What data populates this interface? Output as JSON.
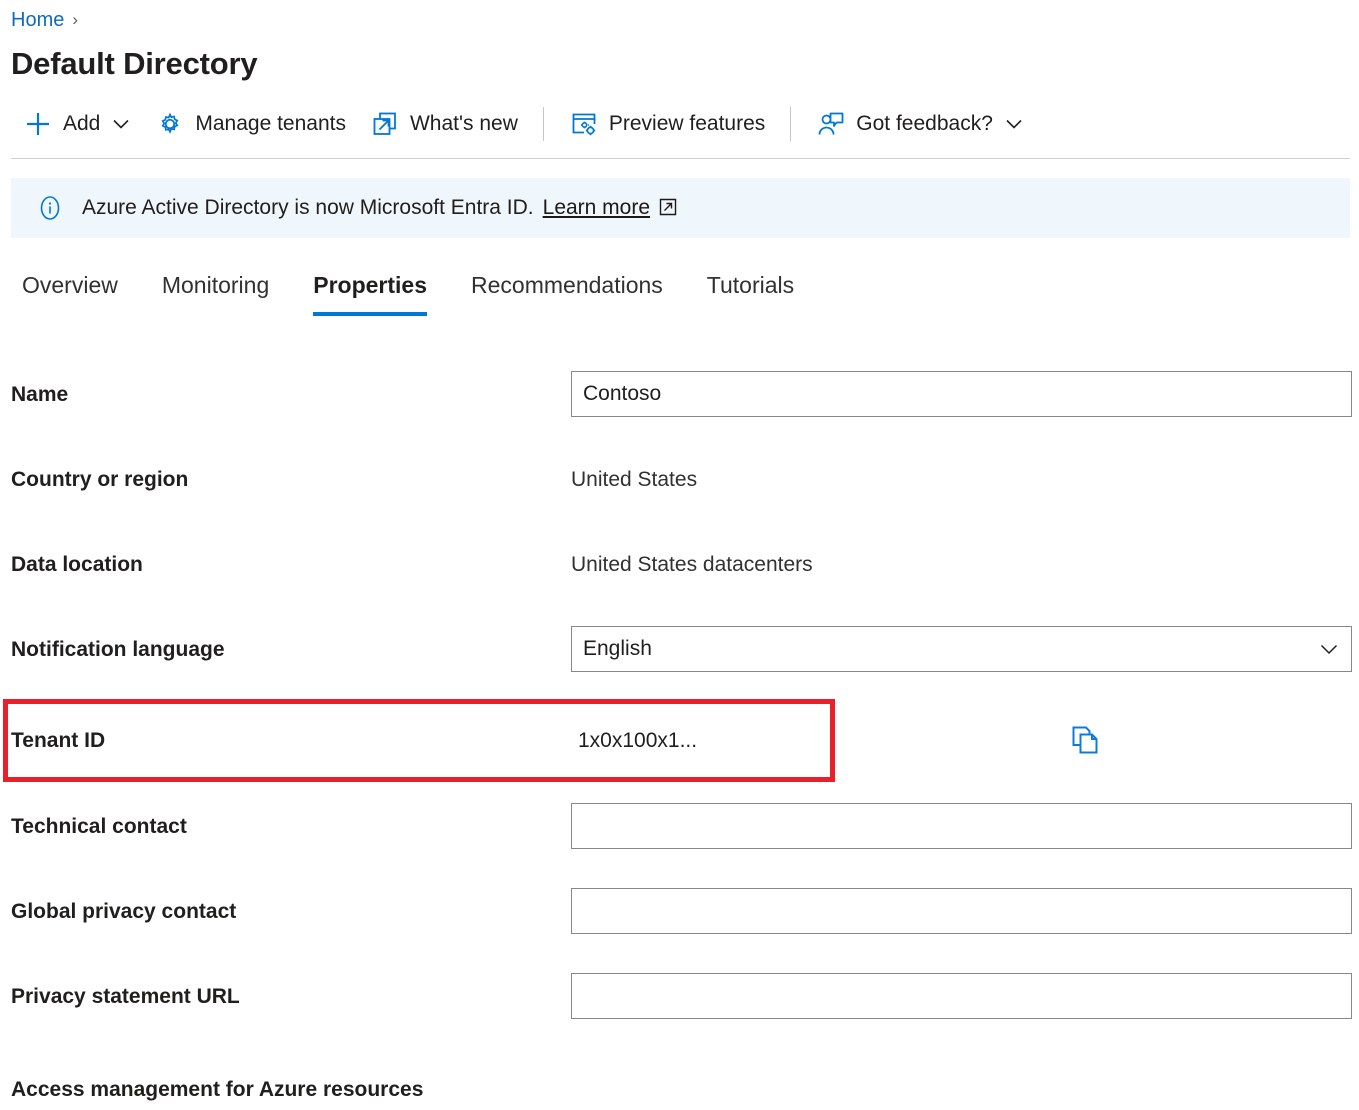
{
  "breadcrumb": {
    "home_label": "Home",
    "separator": "›"
  },
  "page_title": "Default Directory",
  "toolbar": {
    "items": [
      {
        "label": "Add",
        "icon": "plus-icon",
        "has_chevron": true
      },
      {
        "label": "Manage tenants",
        "icon": "gear-icon",
        "has_chevron": false
      },
      {
        "label": "What's new",
        "icon": "external-window-icon",
        "has_chevron": false
      },
      {
        "label": "Preview features",
        "icon": "preview-features-icon",
        "has_chevron": false
      },
      {
        "label": "Got feedback?",
        "icon": "feedback-person-icon",
        "has_chevron": true
      }
    ]
  },
  "banner": {
    "icon": "info-icon",
    "text": "Azure Active Directory is now Microsoft Entra ID.",
    "link_label": "Learn more",
    "link_icon": "external-link-icon",
    "background_color": "#eff6fc"
  },
  "tabs": {
    "items": [
      {
        "label": "Overview",
        "active": false
      },
      {
        "label": "Monitoring",
        "active": false
      },
      {
        "label": "Properties",
        "active": true
      },
      {
        "label": "Recommendations",
        "active": false
      },
      {
        "label": "Tutorials",
        "active": false
      }
    ],
    "active_underline_color": "#0078d4"
  },
  "form": {
    "name": {
      "label": "Name",
      "value": "Contoso",
      "placeholder": ""
    },
    "country_or_region": {
      "label": "Country or region",
      "value": "United States"
    },
    "data_location": {
      "label": "Data location",
      "value": "United States datacenters"
    },
    "notification_language": {
      "label": "Notification language",
      "value": "English",
      "chevron_icon": "chevron-down-icon"
    },
    "tenant_id": {
      "label": "Tenant ID",
      "value": "1x0x100x1...",
      "copy_icon": "copy-icon",
      "highlight_color": "#e8202a"
    },
    "technical_contact": {
      "label": "Technical contact",
      "value": "",
      "placeholder": ""
    },
    "global_privacy_contact": {
      "label": "Global privacy contact",
      "value": "",
      "placeholder": ""
    },
    "privacy_statement_url": {
      "label": "Privacy statement URL",
      "value": "",
      "placeholder": ""
    }
  },
  "section_heading": "Access management for Azure resources",
  "colors": {
    "accent": "#0078d4",
    "link": "#0f6cbd",
    "highlight": "#e8202a",
    "banner_bg": "#eff6fc"
  }
}
